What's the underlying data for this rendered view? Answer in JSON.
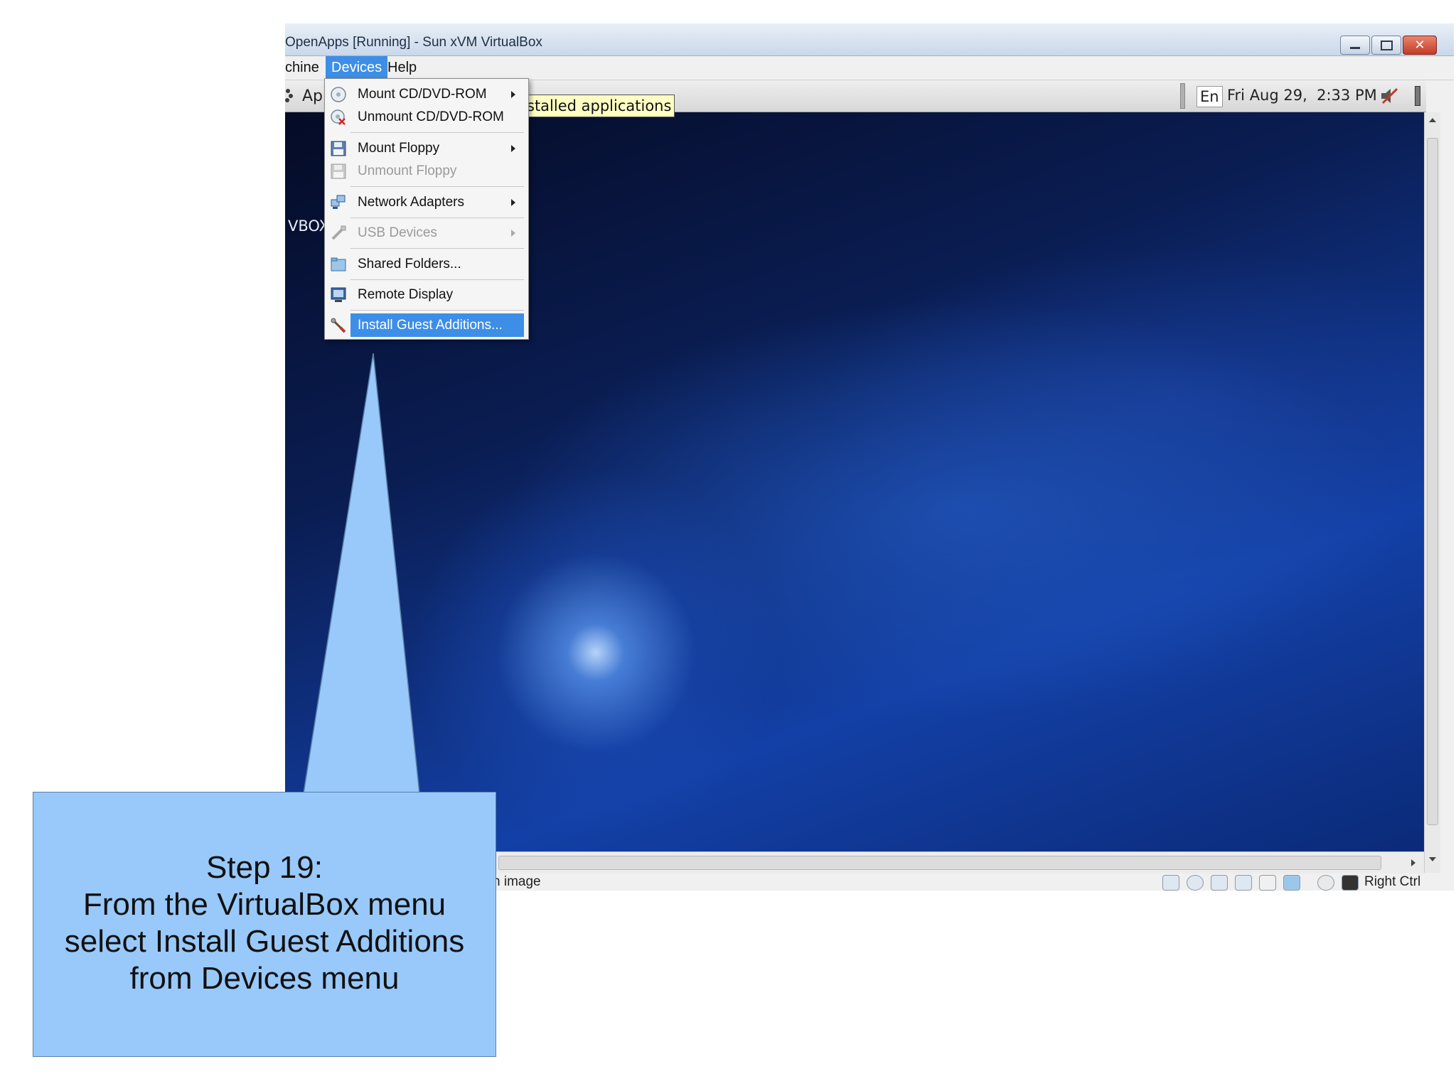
{
  "window": {
    "title": "OpenApps [Running] - Sun xVM VirtualBox"
  },
  "menubar": {
    "machine": "chine",
    "devices": "Devices",
    "help": "Help"
  },
  "guest_panel": {
    "apps_label": "Ap",
    "keyboard_layout": "En",
    "datetime": "Fri Aug 29,  2:33 PM"
  },
  "tooltip": {
    "text": "stalled applications"
  },
  "desktop": {
    "icon_label": "VBOX"
  },
  "devices_menu": {
    "items": [
      {
        "label": "Mount CD/DVD-ROM",
        "icon": "cd-icon",
        "submenu": true,
        "enabled": true
      },
      {
        "label": "Unmount CD/DVD-ROM",
        "icon": "cd-eject-icon",
        "submenu": false,
        "enabled": true
      },
      {
        "label": "Mount Floppy",
        "icon": "floppy-icon",
        "submenu": true,
        "enabled": true
      },
      {
        "label": "Unmount Floppy",
        "icon": "floppy-eject-icon",
        "submenu": false,
        "enabled": false
      },
      {
        "label": "Network Adapters",
        "icon": "network-icon",
        "submenu": true,
        "enabled": true
      },
      {
        "label": "USB Devices",
        "icon": "usb-icon",
        "submenu": true,
        "enabled": false
      },
      {
        "label": "Shared Folders...",
        "icon": "folder-icon",
        "submenu": false,
        "enabled": true
      },
      {
        "label": "Remote Display",
        "icon": "monitor-icon",
        "submenu": false,
        "enabled": true
      },
      {
        "label": "Install Guest Additions...",
        "icon": "wrench-icon",
        "submenu": false,
        "enabled": true,
        "highlighted": true
      }
    ]
  },
  "statusbar": {
    "message": "n image",
    "host_key": "Right Ctrl"
  },
  "callout": {
    "line1": "Step 19:",
    "line2": "From the VirtualBox menu",
    "line3": "select Install Guest Additions",
    "line4": "from Devices menu"
  },
  "colors": {
    "menu_highlight": "#3d8ee6",
    "callout_fill": "#99c9fb",
    "tooltip_bg": "#ffffc4"
  }
}
